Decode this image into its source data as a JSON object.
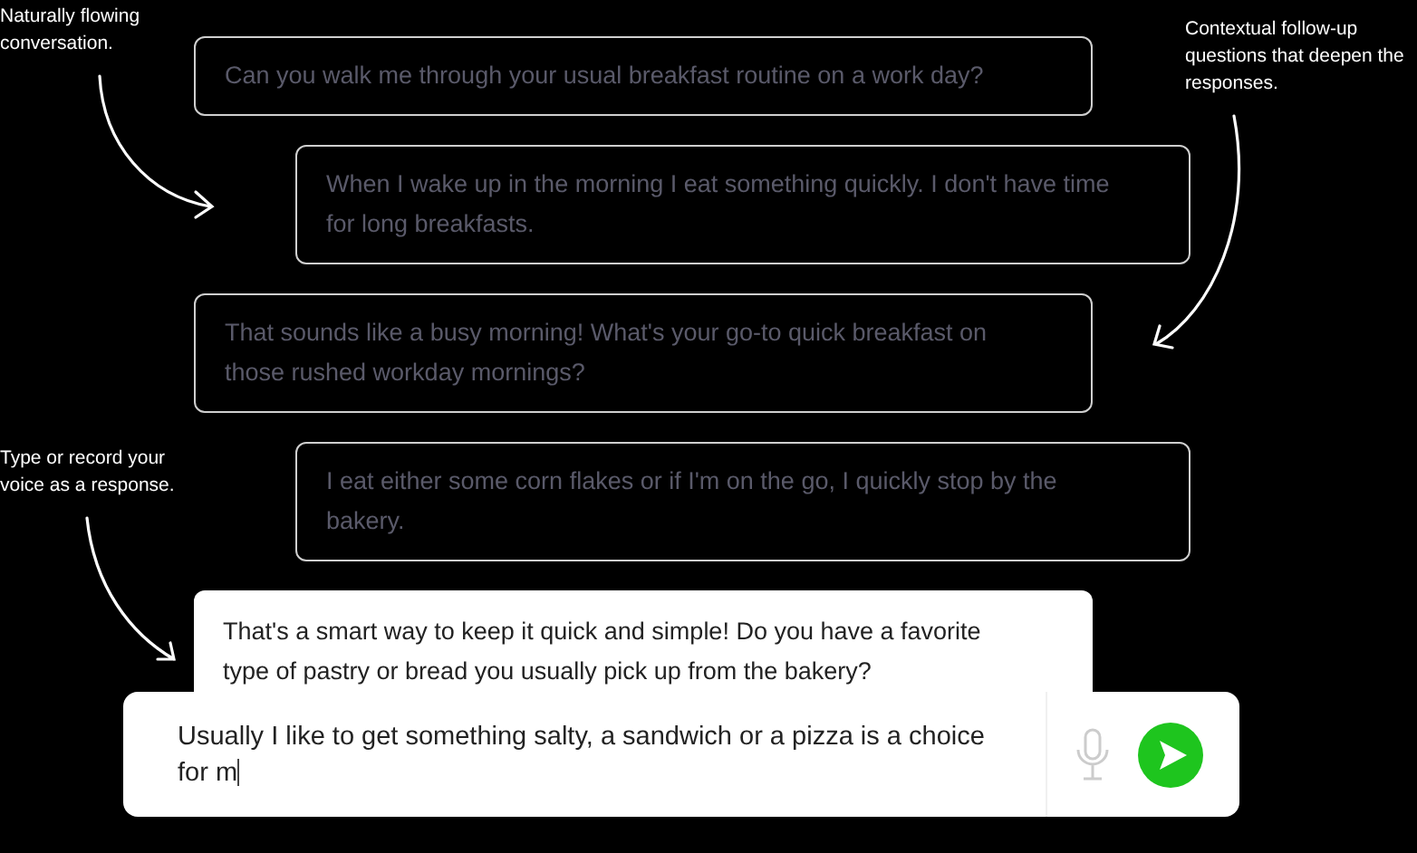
{
  "annotations": [
    {
      "text": "Naturally flowing conversation."
    },
    {
      "text": "Contextual follow-up questions that deepen the responses."
    },
    {
      "text": "Type or record your voice as a response."
    }
  ],
  "messages": [
    {
      "kind": "bot",
      "faded": true,
      "text": "Can you walk me through your usual breakfast routine on a work day?"
    },
    {
      "kind": "user",
      "faded": true,
      "text": "When I wake up in the morning I eat something quickly. I don't have time for long breakfasts."
    },
    {
      "kind": "bot",
      "faded": true,
      "text": "That sounds like a busy morning! What's your go-to quick breakfast on those rushed workday mornings?"
    },
    {
      "kind": "user",
      "faded": true,
      "text": "I eat either some corn flakes or if I'm on the go, I quickly stop by the bakery."
    },
    {
      "kind": "bot",
      "faded": false,
      "text": "That's a smart way to keep it quick and simple! Do you have a favorite type of pastry or bread you usually pick up from the bakery?"
    }
  ],
  "composer": {
    "value": "Usually I like to get something salty, a sandwich or a pizza is a choice for m"
  }
}
